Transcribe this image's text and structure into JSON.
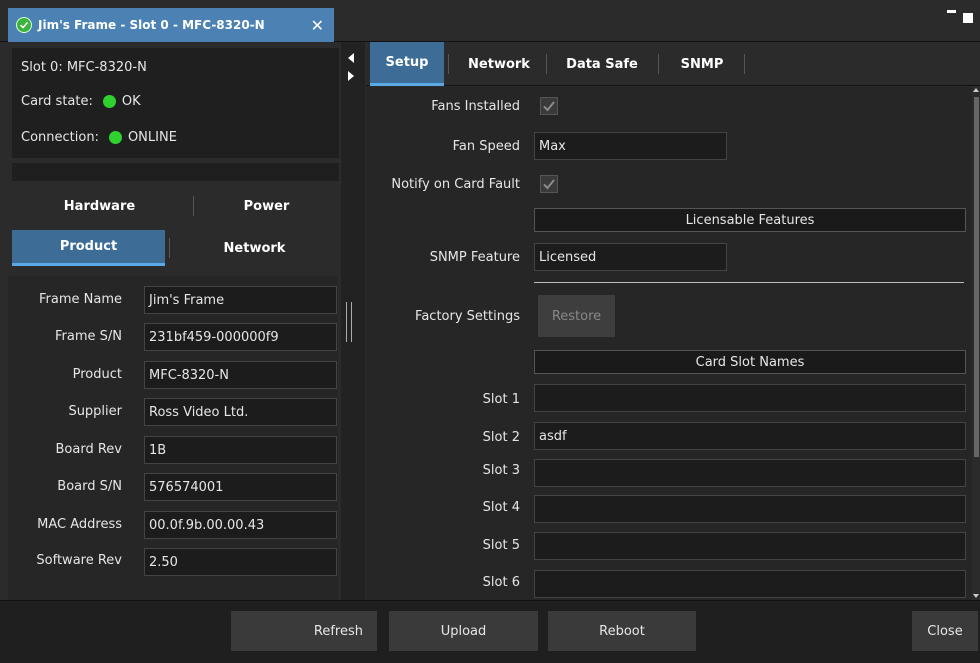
{
  "window": {
    "tab_title": "Jim's Frame - Slot 0 - MFC-8320-N",
    "close_glyph": "✕"
  },
  "info": {
    "slot": "Slot 0: MFC-8320-N",
    "card_state_label": "Card state:",
    "card_state_value": "OK",
    "connection_label": "Connection:",
    "connection_value": "ONLINE",
    "status_color": "#2fd12f"
  },
  "left_tabs": [
    {
      "label": "Hardware"
    },
    {
      "label": "Power"
    },
    {
      "label": "Product"
    },
    {
      "label": "Network"
    }
  ],
  "product_fields": [
    {
      "label": "Frame Name",
      "value": "Jim's Frame"
    },
    {
      "label": "Frame S/N",
      "value": "231bf459-000000f9"
    },
    {
      "label": "Product",
      "value": "MFC-8320-N"
    },
    {
      "label": "Supplier",
      "value": "Ross Video Ltd."
    },
    {
      "label": "Board Rev",
      "value": "1B"
    },
    {
      "label": "Board S/N",
      "value": "576574001"
    },
    {
      "label": "MAC Address",
      "value": "00.0f.9b.00.00.43"
    },
    {
      "label": "Software Rev",
      "value": "2.50"
    }
  ],
  "right_tabs": [
    {
      "label": "Setup"
    },
    {
      "label": "Network"
    },
    {
      "label": "Data Safe"
    },
    {
      "label": "SNMP"
    }
  ],
  "setup": {
    "fans_installed_label": "Fans Installed",
    "fan_speed_label": "Fan Speed",
    "fan_speed_value": "Max",
    "notify_label": "Notify on Card Fault",
    "licensable_header": "Licensable Features",
    "snmp_feature_label": "SNMP Feature",
    "snmp_feature_value": "Licensed",
    "factory_label": "Factory Settings",
    "restore_label": "Restore",
    "slot_names_header": "Card Slot Names",
    "slots": [
      {
        "label": "Slot 1",
        "value": ""
      },
      {
        "label": "Slot 2",
        "value": "asdf"
      },
      {
        "label": "Slot 3",
        "value": ""
      },
      {
        "label": "Slot 4",
        "value": ""
      },
      {
        "label": "Slot 5",
        "value": ""
      },
      {
        "label": "Slot 6",
        "value": ""
      }
    ]
  },
  "buttons": {
    "refresh": "Refresh",
    "upload": "Upload",
    "reboot": "Reboot",
    "close": "Close"
  },
  "colors": {
    "accent": "#3d6d96",
    "accent_underline": "#5aa8e6",
    "tab_title_bg": "#4b82b3"
  }
}
